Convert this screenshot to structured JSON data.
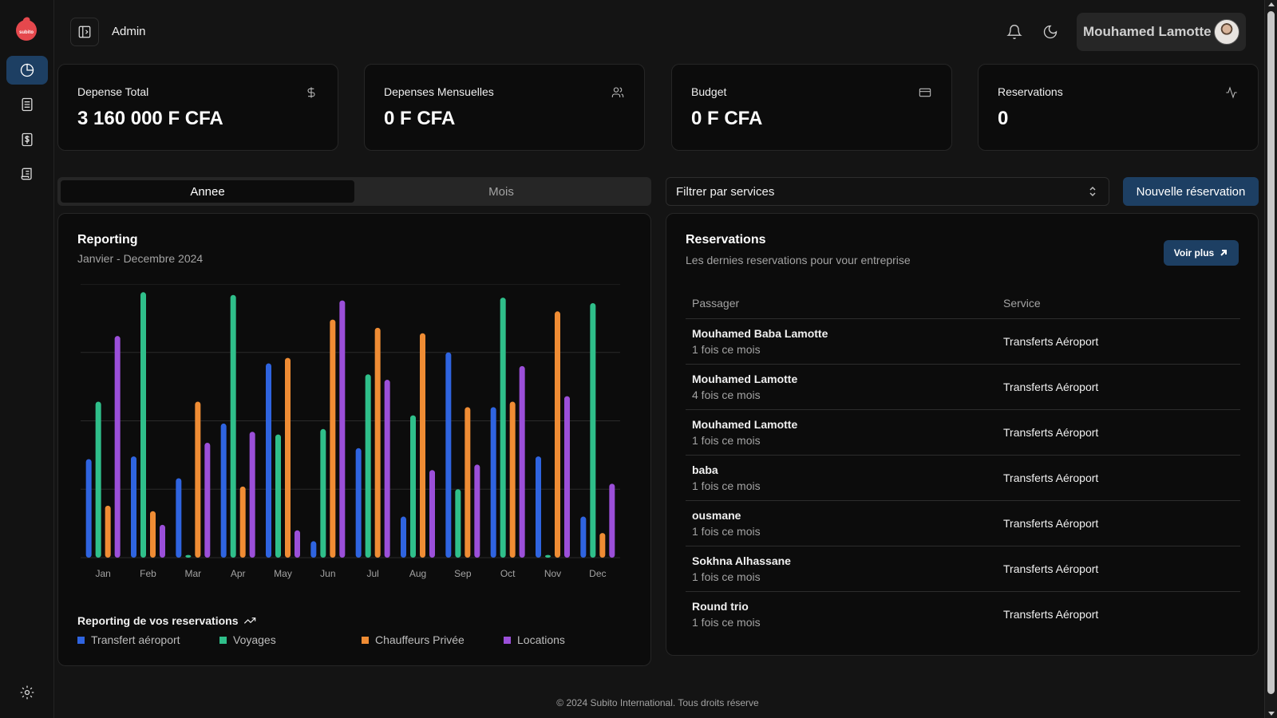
{
  "brand": {
    "logo_text": "subito"
  },
  "sidebar": {
    "items": [
      {
        "name": "dashboard",
        "icon": "pie-chart-icon",
        "active": true
      },
      {
        "name": "reservations",
        "icon": "list-document-icon",
        "active": false
      },
      {
        "name": "billing",
        "icon": "dollar-document-icon",
        "active": false
      },
      {
        "name": "services",
        "icon": "scroll-icon",
        "active": false
      }
    ],
    "settings_icon": "gear-icon"
  },
  "header": {
    "title": "Admin",
    "user_name": "Mouhamed Lamotte"
  },
  "stats": [
    {
      "title": "Depense Total",
      "value": "3 160 000 F CFA",
      "icon": "dollar-icon"
    },
    {
      "title": "Depenses Mensuelles",
      "value": "0 F CFA",
      "icon": "users-icon"
    },
    {
      "title": "Budget",
      "value": "0 F CFA",
      "icon": "credit-card-icon"
    },
    {
      "title": "Reservations",
      "value": "0",
      "icon": "activity-icon"
    }
  ],
  "tabs": [
    {
      "label": "Annee",
      "active": true
    },
    {
      "label": "Mois",
      "active": false
    }
  ],
  "filter": {
    "value": "Filtrer par services"
  },
  "new_button": "Nouvelle réservation",
  "report": {
    "title": "Reporting",
    "subtitle": "Janvier - Decembre 2024",
    "legend_title": "Reporting de vos reservations"
  },
  "chart_data": {
    "type": "bar",
    "categories": [
      "Jan",
      "Feb",
      "Mar",
      "Apr",
      "May",
      "Jun",
      "Jul",
      "Aug",
      "Sep",
      "Oct",
      "Nov",
      "Dec"
    ],
    "ylim": [
      0,
      100
    ],
    "grid": true,
    "legend_position": "bottom",
    "series": [
      {
        "name": "Transfert aéroport",
        "color": "#2f64e0",
        "values": [
          36,
          37,
          29,
          49,
          71,
          6,
          40,
          15,
          75,
          55,
          37,
          15
        ]
      },
      {
        "name": "Voyages",
        "color": "#2fbf8a",
        "values": [
          57,
          97,
          1,
          96,
          45,
          47,
          67,
          52,
          25,
          95,
          1,
          93
        ]
      },
      {
        "name": "Chauffeurs Privée",
        "color": "#ef8c34",
        "values": [
          19,
          17,
          57,
          26,
          73,
          87,
          84,
          82,
          55,
          57,
          90,
          9
        ]
      },
      {
        "name": "Locations",
        "color": "#9b4fd9",
        "values": [
          81,
          12,
          42,
          46,
          10,
          94,
          65,
          32,
          34,
          70,
          59,
          27
        ]
      }
    ]
  },
  "reservations": {
    "title": "Reservations",
    "subtitle": "Les dernies reservations pour vour entreprise",
    "voir_plus": "Voir plus",
    "columns": [
      "Passager",
      "Service"
    ],
    "rows": [
      {
        "name": "Mouhamed Baba Lamotte",
        "count": "1 fois ce mois",
        "service": "Transferts Aéroport"
      },
      {
        "name": "Mouhamed Lamotte",
        "count": "4 fois ce mois",
        "service": "Transferts Aéroport"
      },
      {
        "name": "Mouhamed Lamotte",
        "count": "1 fois ce mois",
        "service": "Transferts Aéroport"
      },
      {
        "name": "baba",
        "count": "1 fois ce mois",
        "service": "Transferts Aéroport"
      },
      {
        "name": "ousmane",
        "count": "1 fois ce mois",
        "service": "Transferts Aéroport"
      },
      {
        "name": "Sokhna Alhassane",
        "count": "1 fois ce mois",
        "service": "Transferts Aéroport"
      },
      {
        "name": "Round trio",
        "count": "1 fois ce mois",
        "service": "Transferts Aéroport"
      }
    ]
  },
  "footer": "© 2024 Subito International. Tous droits réserve"
}
